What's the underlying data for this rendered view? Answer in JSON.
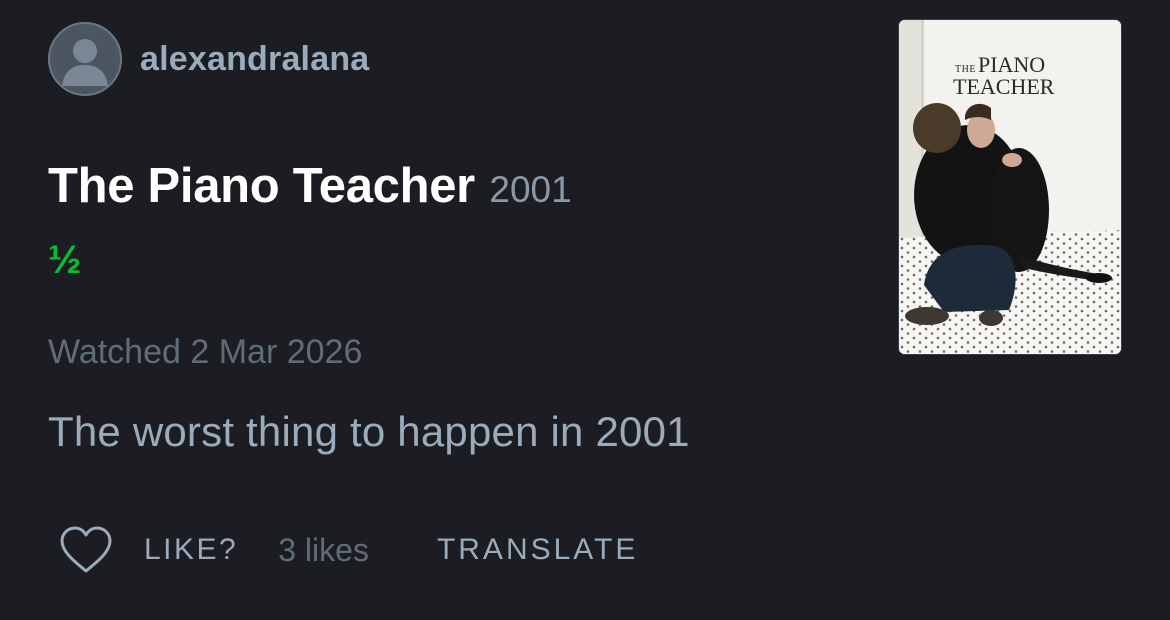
{
  "review": {
    "author": {
      "username": "alexandralana",
      "avatar_icon": "avatar-placeholder-icon"
    },
    "film": {
      "title": "The Piano Teacher",
      "year": "2001"
    },
    "rating": "½",
    "watched": "Watched 2 Mar 2026",
    "text": "The worst thing to happen in 2001",
    "actions": {
      "like_icon": "heart-icon",
      "like_label": "LIKE?",
      "likes_count": "3 likes",
      "translate_label": "TRANSLATE"
    },
    "poster": {
      "title_the": "THE",
      "title_line1": "PIANO",
      "title_line2": "TEACHER"
    }
  },
  "colors": {
    "background": "#1b1d22",
    "title": "#ffffff",
    "muted": "#9aabbc",
    "dim": "#5f6c79",
    "rating_green": "#00c030"
  }
}
